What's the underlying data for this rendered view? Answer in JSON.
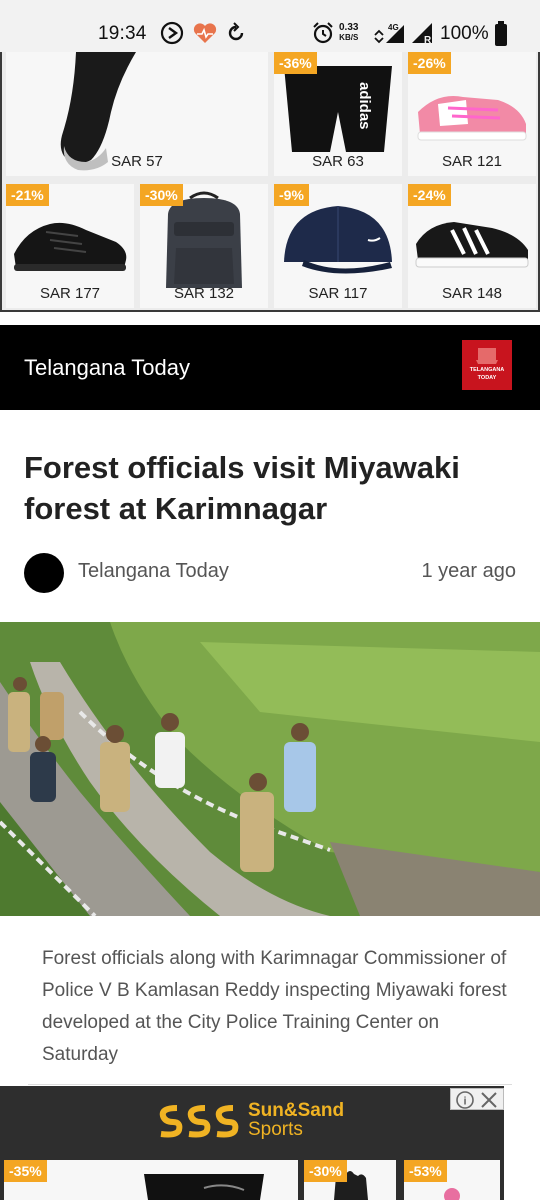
{
  "status_bar": {
    "time": "19:34",
    "speed_value": "0.33",
    "speed_unit": "KB/S",
    "network": "4G",
    "battery": "100%"
  },
  "top_ad": {
    "products": [
      {
        "name": "socks",
        "price": "SAR 57",
        "discount": ""
      },
      {
        "name": "shorts",
        "price": "SAR 63",
        "discount": "-36%"
      },
      {
        "name": "kids-sneakers",
        "price": "SAR 121",
        "discount": "-26%"
      },
      {
        "name": "running-shoes",
        "price": "SAR 177",
        "discount": "-21%"
      },
      {
        "name": "backpack",
        "price": "SAR 132",
        "discount": "-30%"
      },
      {
        "name": "cap",
        "price": "SAR 117",
        "discount": "-9%"
      },
      {
        "name": "trainers",
        "price": "SAR 148",
        "discount": "-24%"
      }
    ]
  },
  "header": {
    "site_name": "Telangana Today",
    "logo_text_1": "TELANGANA",
    "logo_text_2": "TODAY"
  },
  "article": {
    "title": "Forest officials visit Miyawaki forest at Karimnagar",
    "author": "Telangana Today",
    "time_ago": "1 year ago",
    "caption": "Forest officials along with Karimnagar Commissioner of Police V B Kamlasan Reddy inspecting Miyawaki forest developed at the City Police Training Center on Saturday"
  },
  "bottom_ad": {
    "brand_line1": "Sun&Sand",
    "brand_line2": "Sports",
    "discounts": [
      "-35%",
      "-30%",
      "-53%"
    ]
  },
  "colors": {
    "discount_badge": "#f4a623",
    "header_bg": "#000000",
    "logo_red": "#c8141e"
  }
}
